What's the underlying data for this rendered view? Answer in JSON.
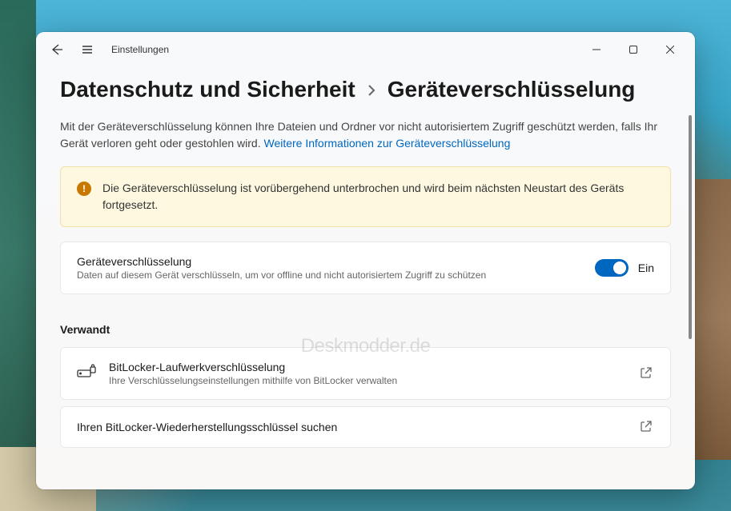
{
  "app": {
    "title": "Einstellungen"
  },
  "breadcrumb": {
    "parent": "Datenschutz und Sicherheit",
    "current": "Geräteverschlüsselung"
  },
  "description": {
    "text": "Mit der Geräteverschlüsselung können Ihre Dateien und Ordner vor nicht autorisiertem Zugriff geschützt werden, falls Ihr Gerät verloren geht oder gestohlen wird. ",
    "linkText": "Weitere Informationen zur Geräteverschlüsselung"
  },
  "alert": {
    "text": "Die Geräteverschlüsselung ist vorübergehend unterbrochen und wird beim nächsten Neustart des Geräts fortgesetzt."
  },
  "encryptionCard": {
    "title": "Geräteverschlüsselung",
    "subtitle": "Daten auf diesem Gerät verschlüsseln, um vor offline und nicht autorisiertem Zugriff zu schützen",
    "toggleState": "Ein"
  },
  "relatedHeader": "Verwandt",
  "bitlockerCard": {
    "title": "BitLocker-Laufwerkverschlüsselung",
    "subtitle": "Ihre Verschlüsselungseinstellungen mithilfe von BitLocker verwalten"
  },
  "recoveryCard": {
    "title": "Ihren BitLocker-Wiederherstellungsschlüssel suchen"
  },
  "watermark": "Deskmodder.de"
}
